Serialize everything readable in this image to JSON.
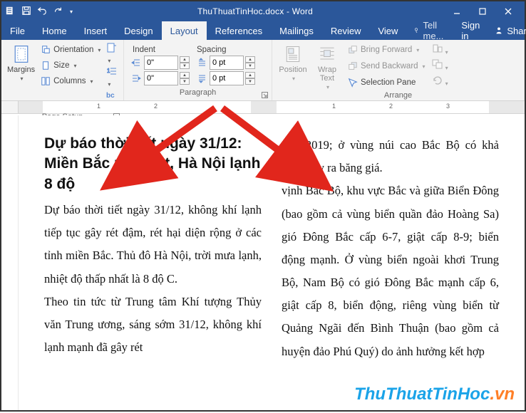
{
  "titlebar": {
    "doc_title": "ThuThuatTinHoc.docx - Word"
  },
  "menutabs": {
    "file": "File",
    "home": "Home",
    "insert": "Insert",
    "design": "Design",
    "layout": "Layout",
    "references": "References",
    "mailings": "Mailings",
    "review": "Review",
    "view": "View",
    "tell_me": "Tell me...",
    "sign_in": "Sign in",
    "share": "Share"
  },
  "ribbon": {
    "page_setup": {
      "label": "Page Setup",
      "margins": "Margins",
      "orientation": "Orientation",
      "size": "Size",
      "columns": "Columns"
    },
    "paragraph": {
      "label": "Paragraph",
      "indent_label": "Indent",
      "spacing_label": "Spacing",
      "indent_left": "0\"",
      "indent_right": "0\"",
      "spacing_before": "0 pt",
      "spacing_after": "0 pt"
    },
    "arrange": {
      "label": "Arrange",
      "position": "Position",
      "wrap_text": "Wrap Text",
      "bring_forward": "Bring Forward",
      "send_backward": "Send Backward",
      "selection_pane": "Selection Pane"
    }
  },
  "ruler": {
    "numbers": [
      "1",
      "2",
      "1",
      "2",
      "3"
    ]
  },
  "document": {
    "heading": "Dự báo thời tiết ngày 31/12: Miền Bắc mưa rét, Hà Nội lạnh 8 độ",
    "col1_p1": "Dự báo thời tiết ngày 31/12, không khí lạnh tiếp tục gây rét đậm, rét hại diện rộng ở các tỉnh miền Bắc. Thủ đô Hà Nội, trời mưa lạnh, nhiệt độ thấp nhất là 8 độ C.",
    "col1_p2": "Theo tin tức từ Trung tâm Khí tượng Thủy văn Trung ương, sáng sớm 31/12, không khí lạnh mạnh đã gây rét",
    "col2_p1": "4/01/2019; ở vùng núi cao Bắc Bộ có khả năng xảy ra băng giá.",
    "col2_p2": "vịnh Bắc Bộ, khu vực Bắc và giữa Biển Đông (bao gồm cả vùng biển quần đảo Hoàng Sa) gió Đông Bắc cấp 6-7, giật cấp 8-9; biển động mạnh. Ở vùng biển ngoài khơi Trung Bộ, Nam Bộ có gió Đông Bắc mạnh cấp 6, giật cấp 8, biển động, riêng vùng biển từ Quảng Ngãi đến Bình Thuận (bao gồm cả huyện đảo Phú Quý) do ảnh hưởng kết hợp"
  },
  "watermark": {
    "part1": "ThuThuatTinHoc",
    "part2": ".vn"
  }
}
